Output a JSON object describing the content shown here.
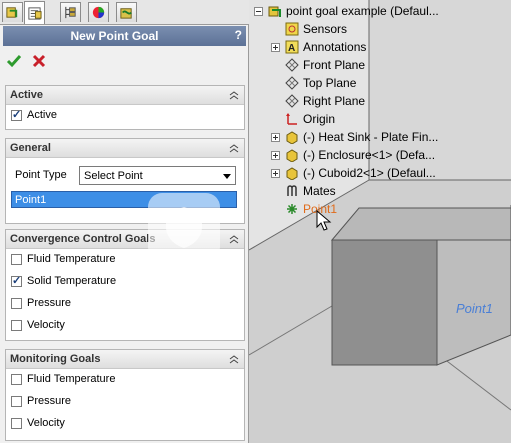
{
  "tabs": [
    {
      "icon": "feature-manager-icon"
    },
    {
      "icon": "property-manager-icon"
    },
    {
      "icon": "configuration-manager-icon"
    },
    {
      "icon": "display-manager-icon"
    },
    {
      "icon": "flow-simulation-icon"
    }
  ],
  "panel": {
    "title": "New Point Goal",
    "help": "?"
  },
  "active_group": {
    "title": "Active",
    "items": [
      {
        "label": "Active",
        "checked": true
      }
    ]
  },
  "general_group": {
    "title": "General",
    "point_type_label": "Point Type",
    "point_type_value": "Select Point",
    "selection": "Point1"
  },
  "convergence_group": {
    "title": "Convergence Control Goals",
    "items": [
      {
        "label": "Fluid Temperature",
        "checked": false
      },
      {
        "label": "Solid Temperature",
        "checked": true
      },
      {
        "label": "Pressure",
        "checked": false
      },
      {
        "label": "Velocity",
        "checked": false
      }
    ]
  },
  "monitoring_group": {
    "title": "Monitoring Goals",
    "items": [
      {
        "label": "Fluid Temperature",
        "checked": false
      },
      {
        "label": "Pressure",
        "checked": false
      },
      {
        "label": "Velocity",
        "checked": false
      }
    ]
  },
  "tree": {
    "root": "point goal example  (Defaul...",
    "items": [
      {
        "label": "Sensors",
        "expandable": false
      },
      {
        "label": "Annotations",
        "expandable": true
      },
      {
        "label": "Front Plane",
        "expandable": false
      },
      {
        "label": "Top Plane",
        "expandable": false
      },
      {
        "label": "Right Plane",
        "expandable": false
      },
      {
        "label": "Origin",
        "expandable": false
      },
      {
        "label": "(-) Heat Sink - Plate Fin...",
        "expandable": true
      },
      {
        "label": "(-) Enclosure<1> (Defa...",
        "expandable": true
      },
      {
        "label": "(-) Cuboid2<1> (Defaul...",
        "expandable": true
      },
      {
        "label": "Mates",
        "expandable": false
      },
      {
        "label": "Point1",
        "expandable": false
      }
    ]
  },
  "graphics": {
    "point_label": "Point1"
  },
  "colors": {
    "title_bar": "#5c7196",
    "selection": "#3d8ee6",
    "accept": "#2e9b2e",
    "cancel": "#c8202a",
    "highlight": "#e06b1a"
  }
}
